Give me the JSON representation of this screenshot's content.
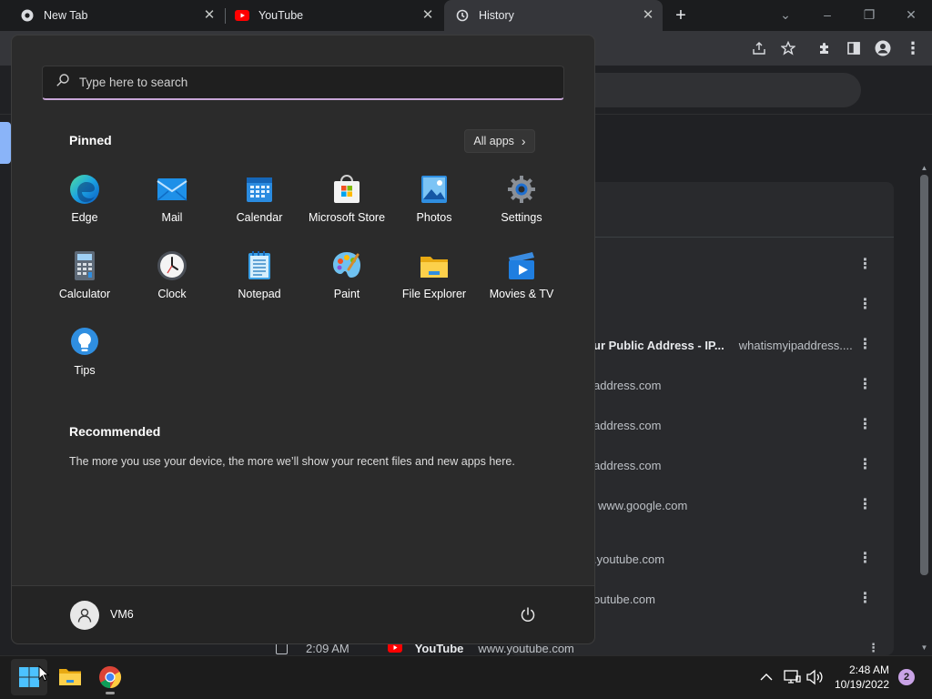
{
  "browser": {
    "tabs": [
      {
        "label": "New Tab",
        "icon": "chrome-icon"
      },
      {
        "label": "YouTube",
        "icon": "youtube-icon"
      },
      {
        "label": "History",
        "icon": "history-icon"
      }
    ],
    "new_tab_symbol": "+"
  },
  "history_page": {
    "rows": [
      {
        "title": "",
        "domain": ""
      },
      {
        "title": "",
        "domain": ""
      },
      {
        "title": "ur Public Address - IP...",
        "domain": "whatismyipaddress...."
      },
      {
        "title": "",
        "domain": "address.com"
      },
      {
        "title": "",
        "domain": "address.com"
      },
      {
        "title": "",
        "domain": "address.com"
      },
      {
        "title": "",
        "domain": "www.google.com"
      },
      {
        "title": "",
        "domain": ".youtube.com"
      },
      {
        "title": "",
        "domain": "outube.com"
      }
    ],
    "bottom_row": {
      "time": "2:09 AM",
      "title": "YouTube",
      "domain": "www.youtube.com"
    }
  },
  "start_menu": {
    "search_placeholder": "Type here to search",
    "pinned_title": "Pinned",
    "all_apps_label": "All apps",
    "pinned_apps": [
      {
        "label": "Edge",
        "icon": "edge-icon"
      },
      {
        "label": "Mail",
        "icon": "mail-icon"
      },
      {
        "label": "Calendar",
        "icon": "calendar-icon"
      },
      {
        "label": "Microsoft Store",
        "icon": "store-icon"
      },
      {
        "label": "Photos",
        "icon": "photos-icon"
      },
      {
        "label": "Settings",
        "icon": "settings-icon"
      },
      {
        "label": "Calculator",
        "icon": "calculator-icon"
      },
      {
        "label": "Clock",
        "icon": "clock-icon"
      },
      {
        "label": "Notepad",
        "icon": "notepad-icon"
      },
      {
        "label": "Paint",
        "icon": "paint-icon"
      },
      {
        "label": "File Explorer",
        "icon": "folder-icon"
      },
      {
        "label": "Movies & TV",
        "icon": "movies-icon"
      },
      {
        "label": "Tips",
        "icon": "tips-icon"
      }
    ],
    "recommended_title": "Recommended",
    "recommended_text": "The more you use your device, the more we’ll show your recent files and new apps here.",
    "user_name": "VM6"
  },
  "taskbar": {
    "time": "2:48 AM",
    "date": "10/19/2022",
    "notification_count": "2"
  },
  "colors": {
    "accent": "#c8a6d8",
    "start_bg": "#2b2b2b",
    "taskbar_bg": "#1c1c1c"
  }
}
